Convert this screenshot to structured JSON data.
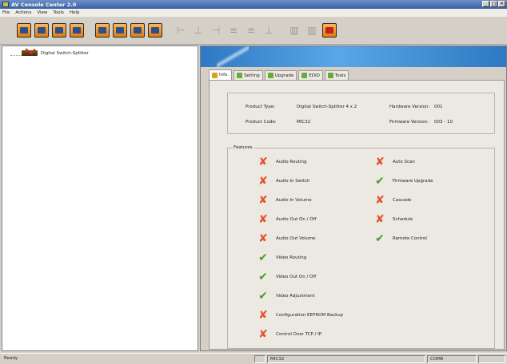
{
  "window": {
    "title": "AV Console Center 2.0",
    "controls": [
      "_",
      "□",
      "×"
    ]
  },
  "menu": [
    "File",
    "Actions",
    "View",
    "Tools",
    "Help"
  ],
  "tree": {
    "node": "Digital Switch-Splitter"
  },
  "tabs": [
    "Info.",
    "Setting",
    "Upgrade",
    "EDID",
    "Tools"
  ],
  "info": {
    "product_type_label": "Product Type:",
    "product_type": "Digital Switch-Splitter 4 x 2",
    "hardware_label": "Hardware Version:",
    "hardware": "001",
    "product_code_label": "Product Code:",
    "product_code": "MIC32",
    "firmware_label": "Firmware Version:",
    "firmware": "003 - 10"
  },
  "features": {
    "legend": "Features",
    "left": [
      {
        "label": "Audio Routing",
        "mark": "✘"
      },
      {
        "label": "Audio In Switch",
        "mark": "✘"
      },
      {
        "label": "Audio In Volume",
        "mark": "✘"
      },
      {
        "label": "Audio Out On / Off",
        "mark": "✘"
      },
      {
        "label": "Audio Out Volume",
        "mark": "✘"
      },
      {
        "label": "Video Routing",
        "mark": "✔"
      },
      {
        "label": "Video Out On / Off",
        "mark": "✔"
      },
      {
        "label": "Video Adjustment",
        "mark": "✔"
      },
      {
        "label": "Configuration EEPROM Backup",
        "mark": "✘"
      },
      {
        "label": "Control Over TCP / IP",
        "mark": "✘"
      }
    ],
    "right": [
      {
        "label": "Auto Scan",
        "mark": "✘"
      },
      {
        "label": "Firmware Upgrade",
        "mark": "✔"
      },
      {
        "label": "Cascade",
        "mark": "✘"
      },
      {
        "label": "Schedule",
        "mark": "✘"
      },
      {
        "label": "Remote Control",
        "mark": "✔"
      }
    ]
  },
  "status": {
    "text": "Ready",
    "device": "MIC32",
    "port": "COM6"
  }
}
